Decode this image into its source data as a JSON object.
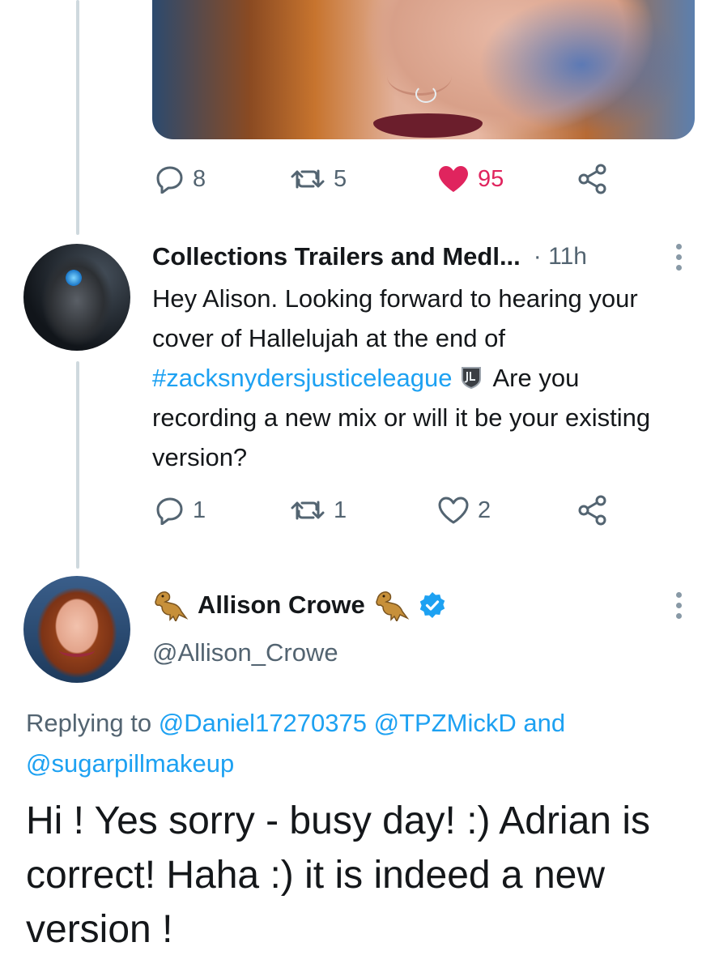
{
  "tweet1": {
    "actions": {
      "replies": "8",
      "retweets": "5",
      "likes": "95"
    }
  },
  "tweet2": {
    "display_name": "Collections Trailers and Medl...",
    "time": "· 11h",
    "text_pre": "Hey Alison. Looking forward to hearing your cover of Hallelujah at the end of ",
    "hashtag": "#zacksnydersjusticeleague",
    "text_post": "Are you recording a new mix or will it be your existing version?",
    "actions": {
      "replies": "1",
      "retweets": "1",
      "likes": "2"
    }
  },
  "tweet3": {
    "display_name": "Allison Crowe",
    "handle": "@Allison_Crowe",
    "replying_prefix": "Replying to",
    "mentions": [
      "@Daniel17270375",
      "@TPZMickD",
      "@sugarpillmakeup"
    ],
    "replying_and": "and",
    "text": "Hi ! Yes sorry - busy day! :)  Adrian is correct! Haha :) it is indeed a new version !"
  },
  "colors": {
    "accent": "#1da1f2",
    "like": "#e0245e",
    "muted": "#536471",
    "verified": "#1da1f2"
  }
}
